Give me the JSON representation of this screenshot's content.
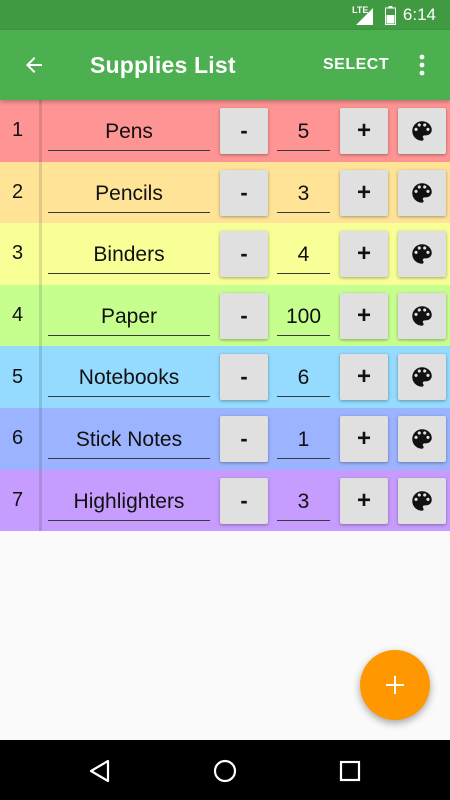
{
  "status_bar": {
    "network": "LTE",
    "time": "6:14"
  },
  "app_bar": {
    "title": "Supplies List",
    "select_label": "SELECT"
  },
  "items": [
    {
      "index": "1",
      "name": "Pens",
      "quantity": "5",
      "color": "#ff9494"
    },
    {
      "index": "2",
      "name": "Pencils",
      "quantity": "3",
      "color": "#ffe396"
    },
    {
      "index": "3",
      "name": "Binders",
      "quantity": "4",
      "color": "#f7ff96"
    },
    {
      "index": "4",
      "name": "Paper",
      "quantity": "100",
      "color": "#c7ff8f"
    },
    {
      "index": "5",
      "name": "Notebooks",
      "quantity": "6",
      "color": "#94dbff"
    },
    {
      "index": "6",
      "name": "Stick Notes",
      "quantity": "1",
      "color": "#9cb3ff"
    },
    {
      "index": "7",
      "name": "Highlighters",
      "quantity": "3",
      "color": "#c79cff"
    }
  ],
  "buttons": {
    "minus": "-",
    "plus": "+"
  },
  "icons": {
    "back": "arrow-back-icon",
    "overflow": "more-vert-icon",
    "palette": "palette-icon",
    "fab": "add-icon",
    "nav_back": "triangle-back-icon",
    "nav_home": "circle-home-icon",
    "nav_recents": "square-recents-icon"
  },
  "colors": {
    "status_bar": "#3f9a41",
    "app_bar": "#4caf50",
    "fab": "#ff9800",
    "background": "#fafafa"
  }
}
